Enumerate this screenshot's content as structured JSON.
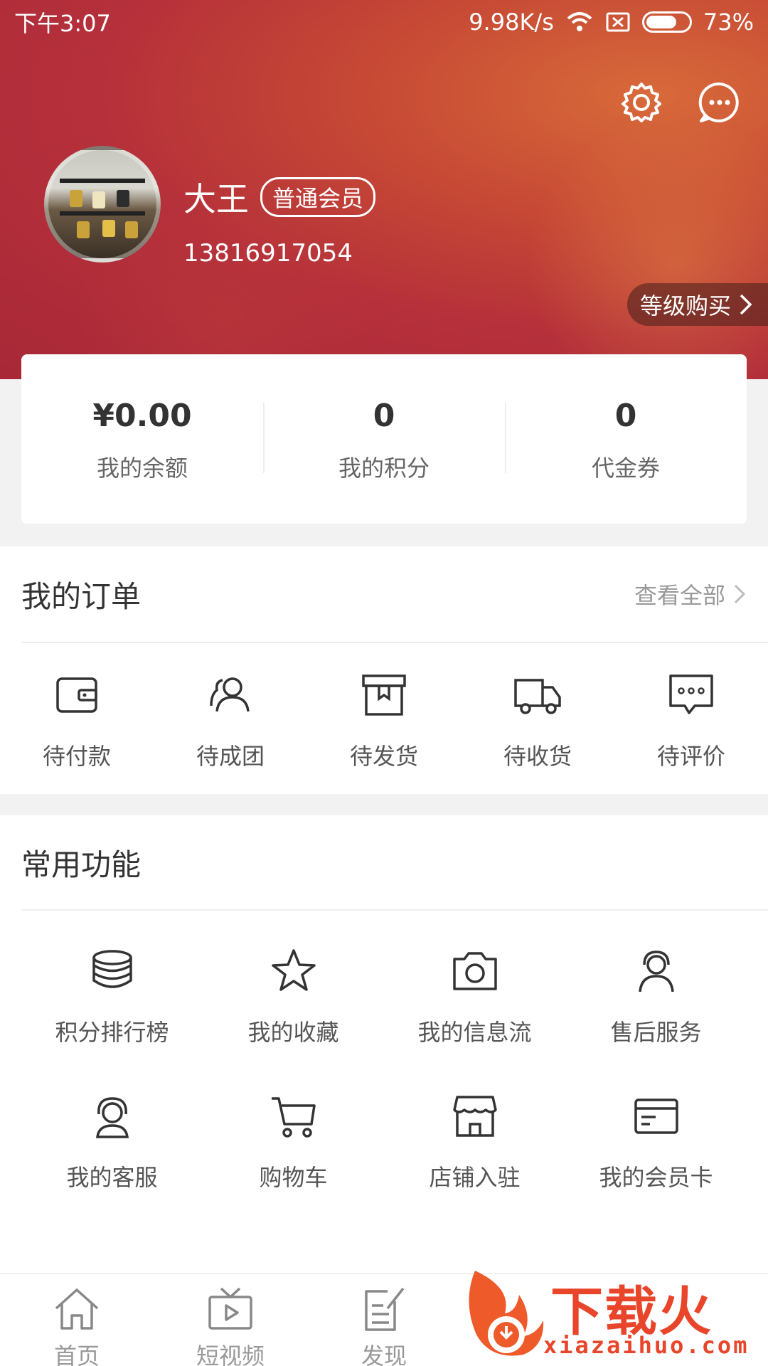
{
  "status_bar": {
    "time": "下午3:07",
    "network_speed": "9.98K/s",
    "battery": "73%",
    "battery_level": 0.73
  },
  "header": {
    "icons": [
      "gear-icon",
      "chat-bubble-icon"
    ],
    "user_name": "大王",
    "member_level": "普通会员",
    "phone": "13816917054",
    "level_buy_label": "等级购买",
    "colors": {
      "primary_red": "#b5303a",
      "accent_orange": "#d86a3a"
    }
  },
  "stats": [
    {
      "value": "¥0.00",
      "label": "我的余额"
    },
    {
      "value": "0",
      "label": "我的积分"
    },
    {
      "value": "0",
      "label": "代金券"
    }
  ],
  "orders": {
    "title": "我的订单",
    "view_all": "查看全部",
    "items": [
      {
        "label": "待付款",
        "icon": "wallet-icon"
      },
      {
        "label": "待成团",
        "icon": "group-icon"
      },
      {
        "label": "待发货",
        "icon": "box-icon"
      },
      {
        "label": "待收货",
        "icon": "truck-icon"
      },
      {
        "label": "待评价",
        "icon": "comment-icon"
      }
    ]
  },
  "functions": {
    "title": "常用功能",
    "items": [
      {
        "label": "积分排行榜",
        "icon": "coins-stack-icon"
      },
      {
        "label": "我的收藏",
        "icon": "star-icon"
      },
      {
        "label": "我的信息流",
        "icon": "camera-icon"
      },
      {
        "label": "售后服务",
        "icon": "headset-user-icon"
      },
      {
        "label": "我的客服",
        "icon": "customer-service-icon"
      },
      {
        "label": "购物车",
        "icon": "cart-icon"
      },
      {
        "label": "店铺入驻",
        "icon": "store-icon"
      },
      {
        "label": "我的会员卡",
        "icon": "card-icon"
      }
    ]
  },
  "tabbar": [
    {
      "label": "首页",
      "icon": "home-icon"
    },
    {
      "label": "短视频",
      "icon": "tv-play-icon"
    },
    {
      "label": "发现",
      "icon": "edit-note-icon"
    }
  ],
  "watermark": {
    "text": "下载火",
    "domain": "xiazaihuo.com"
  }
}
